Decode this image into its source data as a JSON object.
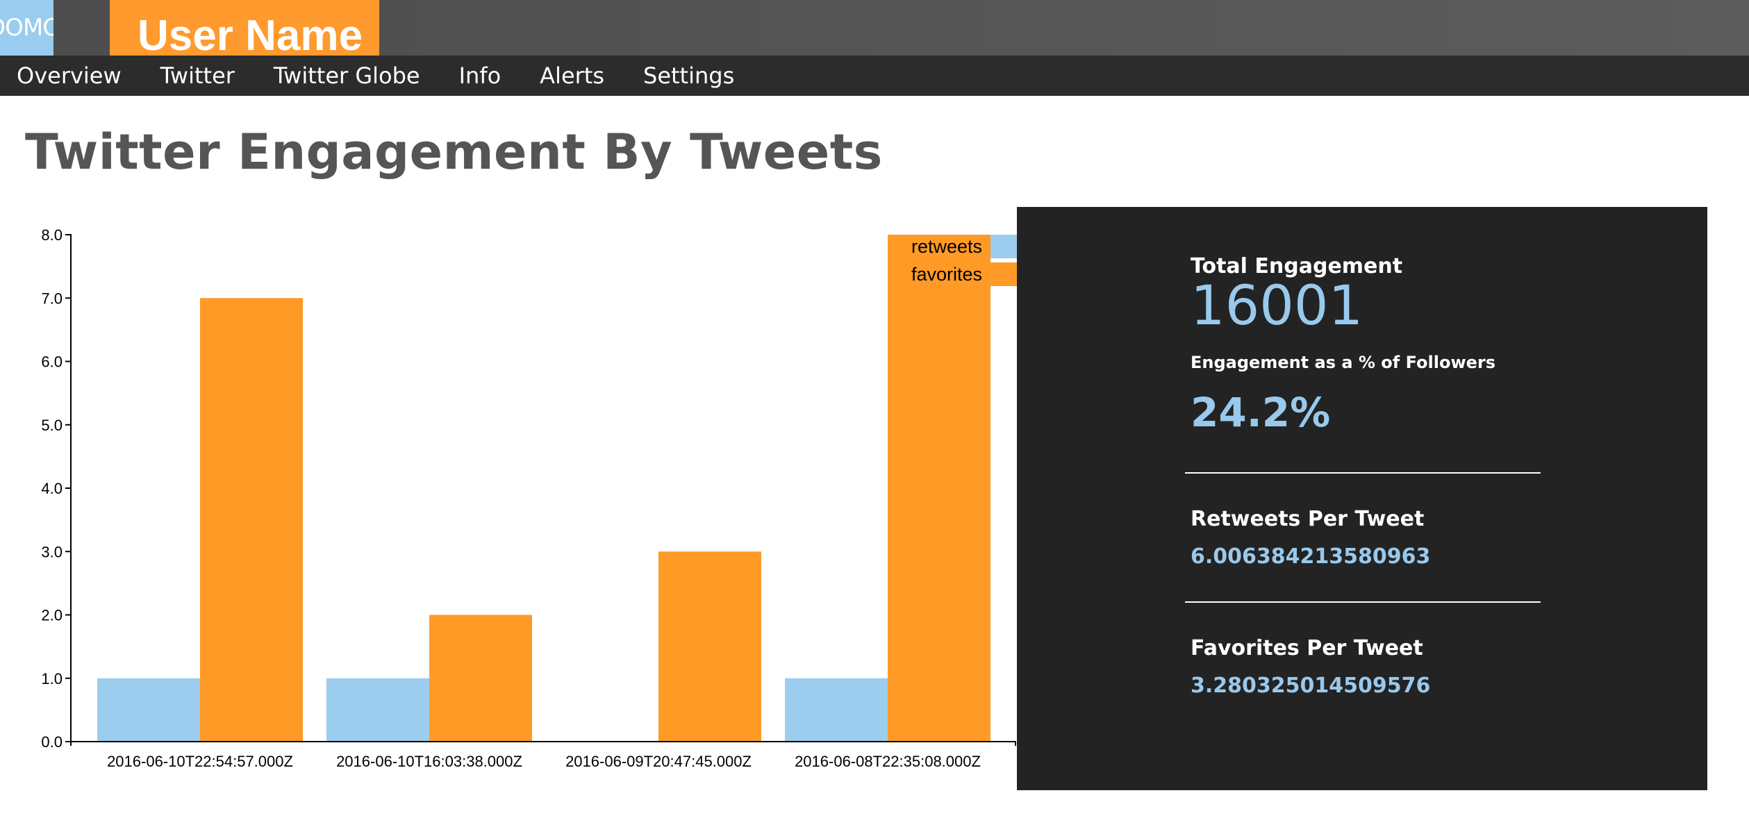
{
  "header": {
    "logo_text": "DOMO",
    "user_name": "User Name"
  },
  "nav": {
    "items": [
      {
        "label": "Overview"
      },
      {
        "label": "Twitter"
      },
      {
        "label": "Twitter Globe"
      },
      {
        "label": "Info"
      },
      {
        "label": "Alerts"
      },
      {
        "label": "Settings"
      }
    ]
  },
  "page": {
    "title": "Twitter Engagement By Tweets"
  },
  "colors": {
    "retweets": "#9dcdee",
    "favorites": "#ff9a26",
    "panel_bg": "#232323",
    "accent_value": "#99c9ec",
    "user_tab": "#ff9a2e"
  },
  "chart_data": {
    "type": "bar",
    "categories": [
      "2016-06-10T22:54:57.000Z",
      "2016-06-10T16:03:38.000Z",
      "2016-06-09T20:47:45.000Z",
      "2016-06-08T22:35:08.000Z"
    ],
    "series": [
      {
        "name": "retweets",
        "values": [
          1,
          1,
          0,
          1
        ]
      },
      {
        "name": "favorites",
        "values": [
          7,
          2,
          3,
          8
        ]
      }
    ],
    "y_ticks": [
      "0.0",
      "1.0",
      "2.0",
      "3.0",
      "4.0",
      "5.0",
      "6.0",
      "7.0",
      "8.0"
    ],
    "ylim": [
      0,
      8
    ],
    "grid": false,
    "legend_position": "top-right"
  },
  "stats": {
    "total_engagement_label": "Total Engagement",
    "total_engagement_value": "16001",
    "engagement_pct_label": "Engagement as a % of Followers",
    "engagement_pct_value": "24.2%",
    "retweets_per_tweet_label": "Retweets Per Tweet",
    "retweets_per_tweet_value": "6.006384213580963",
    "favorites_per_tweet_label": "Favorites Per Tweet",
    "favorites_per_tweet_value": "3.280325014509576"
  }
}
